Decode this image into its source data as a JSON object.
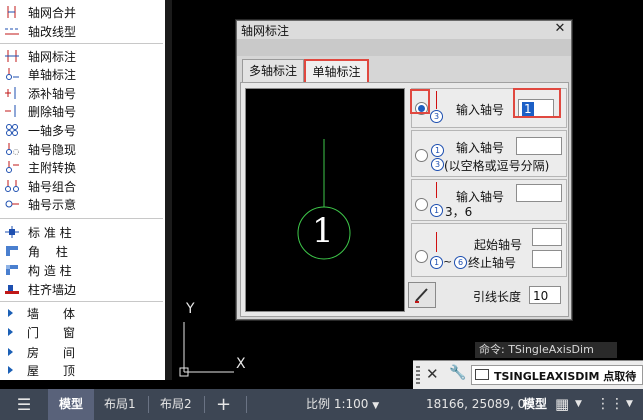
{
  "menu": {
    "group1": [
      {
        "label": "轴网合并",
        "icon": "axis-merge-icon"
      },
      {
        "label": "轴改线型",
        "icon": "axis-linetype-icon"
      }
    ],
    "group2": [
      {
        "label": "轴网标注",
        "icon": "axis-dim-icon"
      },
      {
        "label": "单轴标注",
        "icon": "single-axis-dim-icon"
      },
      {
        "label": "添补轴号",
        "icon": "add-axis-number-icon"
      },
      {
        "label": "删除轴号",
        "icon": "delete-axis-number-icon"
      },
      {
        "label": "一轴多号",
        "icon": "multi-number-icon"
      },
      {
        "label": "轴号隐现",
        "icon": "axis-number-visibility-icon"
      },
      {
        "label": "主附转换",
        "icon": "main-sub-convert-icon"
      },
      {
        "label": "轴号组合",
        "icon": "axis-number-combine-icon"
      },
      {
        "label": "轴号示意",
        "icon": "axis-number-sketch-icon"
      }
    ],
    "group3": [
      {
        "label": "标 准 柱",
        "icon": "standard-column-icon"
      },
      {
        "label": "角　 柱",
        "icon": "corner-column-icon"
      },
      {
        "label": "构 造 柱",
        "icon": "structural-column-icon"
      },
      {
        "label": "柱齐墙边",
        "icon": "column-align-wall-icon"
      }
    ],
    "group4": [
      {
        "label": "墙　　体"
      },
      {
        "label": "门　　窗"
      },
      {
        "label": "房　　间"
      },
      {
        "label": "屋　　顶"
      }
    ]
  },
  "dialog": {
    "title": "轴网标注",
    "tabs": [
      {
        "label": "多轴标注",
        "active": false
      },
      {
        "label": "单轴标注",
        "active": true
      }
    ],
    "preview_number": "1",
    "option1": {
      "label": "输入轴号",
      "value": "1",
      "icon_number": "3"
    },
    "option2": {
      "label": "输入轴号",
      "hint": "(以空格或逗号分隔)",
      "value": "",
      "icon_numbers": [
        "1",
        "3"
      ]
    },
    "option3": {
      "label": "输入轴号",
      "sample": "3，6",
      "value": "",
      "icon_number": "1"
    },
    "option4": {
      "start_label": "起始轴号",
      "end_label": "终止轴号",
      "start_value": "",
      "end_value": "",
      "icon_numbers": [
        "1",
        "6"
      ],
      "tilde": "~"
    },
    "leader_label": "引线长度",
    "leader_value": "10"
  },
  "drawing": {
    "ucs_y": "Y",
    "ucs_x": "X"
  },
  "command": {
    "hint": "命令: TSingleAxisDim",
    "input": "TSINGLEAXISDIM 点取待"
  },
  "status": {
    "model_tab": "模型",
    "layout1": "布局1",
    "layout2": "布局2",
    "plus": "+",
    "scale": "比例 1:100",
    "coords": "18166, 25089, 0",
    "mode": "模型"
  },
  "colors": {
    "accent_red": "#e0483f",
    "radio_blue": "#1d5fbf",
    "preview_green": "#3ec84a",
    "status_bg": "#3d4654"
  }
}
